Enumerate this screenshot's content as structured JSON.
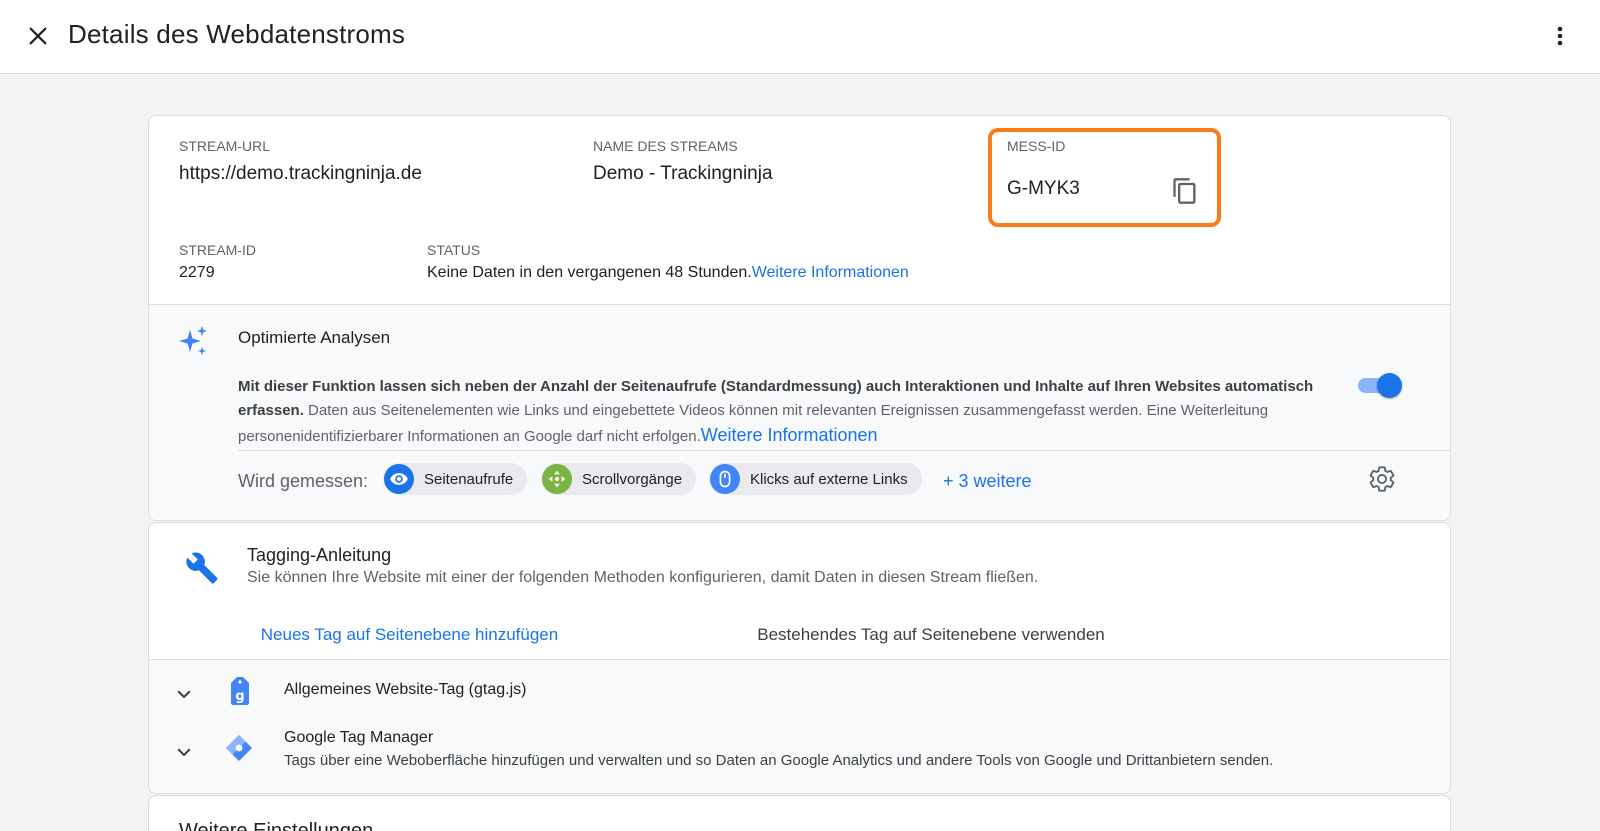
{
  "header": {
    "title": "Details des Webdatenstroms"
  },
  "stream": {
    "url_label": "STREAM-URL",
    "url": "https://demo.trackingninja.de",
    "name_label": "NAME DES STREAMS",
    "name": "Demo - Trackingninja",
    "mess_label": "MESS-ID",
    "mess_id": "G-MYK3",
    "id_label": "STREAM-ID",
    "id": "2279",
    "status_label": "STATUS",
    "status_text": "Keine Daten in den vergangenen 48 Stunden.",
    "status_link": "Weitere Informationen"
  },
  "enhanced": {
    "title": "Optimierte Analysen",
    "desc_strong": "Mit dieser Funktion lassen sich neben der Anzahl der Seitenaufrufe (Standardmessung) auch Interaktionen und Inhalte auf Ihren Websites automatisch erfassen.",
    "desc": " Daten aus Seitenelementen wie Links und eingebettete Videos können mit relevanten Ereignissen zusammengefasst werden. Eine Weiterleitung personenidentifizierbarer Informationen an Google darf nicht erfolgen.",
    "link": "Weitere Informationen",
    "toggle_on": true,
    "measured_label": "Wird gemessen:",
    "chips": [
      {
        "label": "Seitenaufrufe",
        "icon": "eye-icon",
        "color": "#1a73e8"
      },
      {
        "label": "Scrollvorgänge",
        "icon": "scroll-icon",
        "color": "#7cb342"
      },
      {
        "label": "Klicks auf externe Links",
        "icon": "mouse-icon",
        "color": "#4285f4"
      }
    ],
    "more": "+ 3 weitere"
  },
  "tagging": {
    "title": "Tagging-Anleitung",
    "subtitle": "Sie können Ihre Website mit einer der folgenden Methoden konfigurieren, damit Daten in diesen Stream fließen.",
    "tabs": [
      {
        "label": "Neues Tag auf Seitenebene hinzufügen",
        "active": true
      },
      {
        "label": "Bestehendes Tag auf Seitenebene verwenden",
        "active": false
      }
    ],
    "methods": [
      {
        "title": "Allgemeines Website-Tag (gtag.js)",
        "desc": ""
      },
      {
        "title": "Google Tag Manager",
        "desc": "Tags über eine Weboberfläche hinzufügen und verwalten und so Daten an Google Analytics und andere Tools von Google und Drittanbietern senden."
      }
    ]
  },
  "more_settings": {
    "title": "Weitere Einstellungen"
  },
  "colors": {
    "accent": "#1a73e8",
    "highlight": "#fa7b17"
  }
}
